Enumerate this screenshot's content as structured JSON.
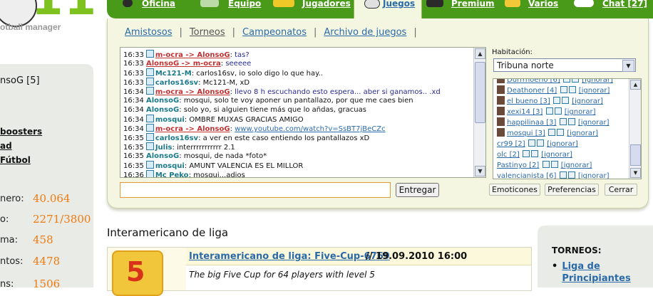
{
  "brand": {
    "logo_text": "11",
    "tagline": "otball manager"
  },
  "nav": {
    "items": [
      {
        "label": "Oficina"
      },
      {
        "label": "Equipo"
      },
      {
        "label": "Jugadores"
      },
      {
        "label": "Juegos"
      },
      {
        "label": "Premium"
      },
      {
        "label": "Varios"
      },
      {
        "label": "Chat [27]"
      }
    ],
    "active": "Juegos"
  },
  "subnav": [
    "Amistosos",
    "Torneos",
    "Campeonatos",
    "Archivo de juegos"
  ],
  "chat": {
    "lines": [
      {
        "time": "16:33",
        "user": "m-ocra -> AlonsoG",
        "private": true,
        "text": "tas?"
      },
      {
        "time": "16:33",
        "user": "AlonsoG -> m-ocra",
        "private": true,
        "text": "seeeee",
        "noicon": true
      },
      {
        "time": "16:33",
        "user": "Mc121-M",
        "private": false,
        "text": "carlos16sv, io solo digo lo que hay.."
      },
      {
        "time": "16:33",
        "user": "carlos16sv",
        "private": false,
        "text": "Mc121-M, xD"
      },
      {
        "time": "16:34",
        "user": "m-ocra -> AlonsoG",
        "private": true,
        "text": "llevo 8 h escuchando esto espera... aber si ganamos.. .xd"
      },
      {
        "time": "16:34",
        "user": "AlonsoG",
        "private": false,
        "text": "mosqui, solo te voy aponer un pantallazo, por que me caes bien",
        "noicon": true
      },
      {
        "time": "16:34",
        "user": "AlonsoG",
        "private": false,
        "text": "solo yo, si alguien tiene más que lo añdas, gracuas",
        "noicon": true
      },
      {
        "time": "16:34",
        "user": "mosqui",
        "private": false,
        "text": "OMBRE MUXAS GRACIAS AMIGO"
      },
      {
        "time": "16:34",
        "user": "m-ocra -> AlonsoG",
        "private": true,
        "text": "www.youtube.com/watch?v=SsBT7jBeCZc",
        "link": true
      },
      {
        "time": "16:35",
        "user": "carlos16sv",
        "private": false,
        "text": "a ver en este caso entiendo los pantallazos xD"
      },
      {
        "time": "16:35",
        "user": "Julis",
        "private": false,
        "text": "interrrrrrrrrrr 2.1"
      },
      {
        "time": "16:35",
        "user": "AlonsoG",
        "private": false,
        "text": "mosqui, de nada *foto*",
        "noicon": true
      },
      {
        "time": "16:35",
        "user": "mosqui",
        "private": false,
        "text": "AMUNT VALENCIA ES EL MILLOR"
      },
      {
        "time": "16:36",
        "user": "Mc Peko",
        "private": false,
        "text": "mosqui...adios"
      }
    ],
    "input_value": "",
    "send_label": "Entregar"
  },
  "room": {
    "label": "Habitación:",
    "selected": "Tribuna norte"
  },
  "users": [
    {
      "name": "Durrrnoerlo [6]",
      "avatar": true
    },
    {
      "name": "Deathoner [4]",
      "avatar": true
    },
    {
      "name": "el bueno [3]",
      "avatar": true
    },
    {
      "name": "xexi14 [3]",
      "avatar": true
    },
    {
      "name": "happilinaa [3]",
      "avatar": true
    },
    {
      "name": "mosqui [3]",
      "avatar": true
    },
    {
      "name": "cr99 [2]",
      "avatar": false
    },
    {
      "name": "olc [2]",
      "avatar": false
    },
    {
      "name": "Pastinyo [2]",
      "avatar": false
    },
    {
      "name": "valencianista [6]",
      "avatar": false
    }
  ],
  "ignore_label": "[ignorar]",
  "buttons": {
    "emotions": "Emoticones",
    "prefs": "Preferencias",
    "close": "Cerrar"
  },
  "left": {
    "user": "nsoG [5]",
    "links": [
      "boosters",
      "ad",
      "Fútbol"
    ],
    "stats": [
      {
        "label": "nero:",
        "value": "40.064"
      },
      {
        "label": "o:",
        "value": "2271/3800"
      },
      {
        "label": "ma:",
        "value": "458"
      },
      {
        "label": "ntos:",
        "value": "4478"
      },
      {
        "label": "ns:",
        "value": "1506"
      }
    ]
  },
  "section": {
    "title": "Interamericano de liga"
  },
  "tournament": {
    "link": "Interamericano de liga: Five-Cup-6769",
    "date": "// 19.09.2010 16:00",
    "desc": "The big Five Cup for 64 players with level 5",
    "badge": "5"
  },
  "rightbox": {
    "heading": "TORNEOS:",
    "item": "Liga de Principiantes"
  },
  "colors": {
    "nav_green": "#4a9a1a",
    "accent_orange": "#f07a10",
    "link_blue": "#2a6aa8",
    "private_red": "#c23232"
  }
}
